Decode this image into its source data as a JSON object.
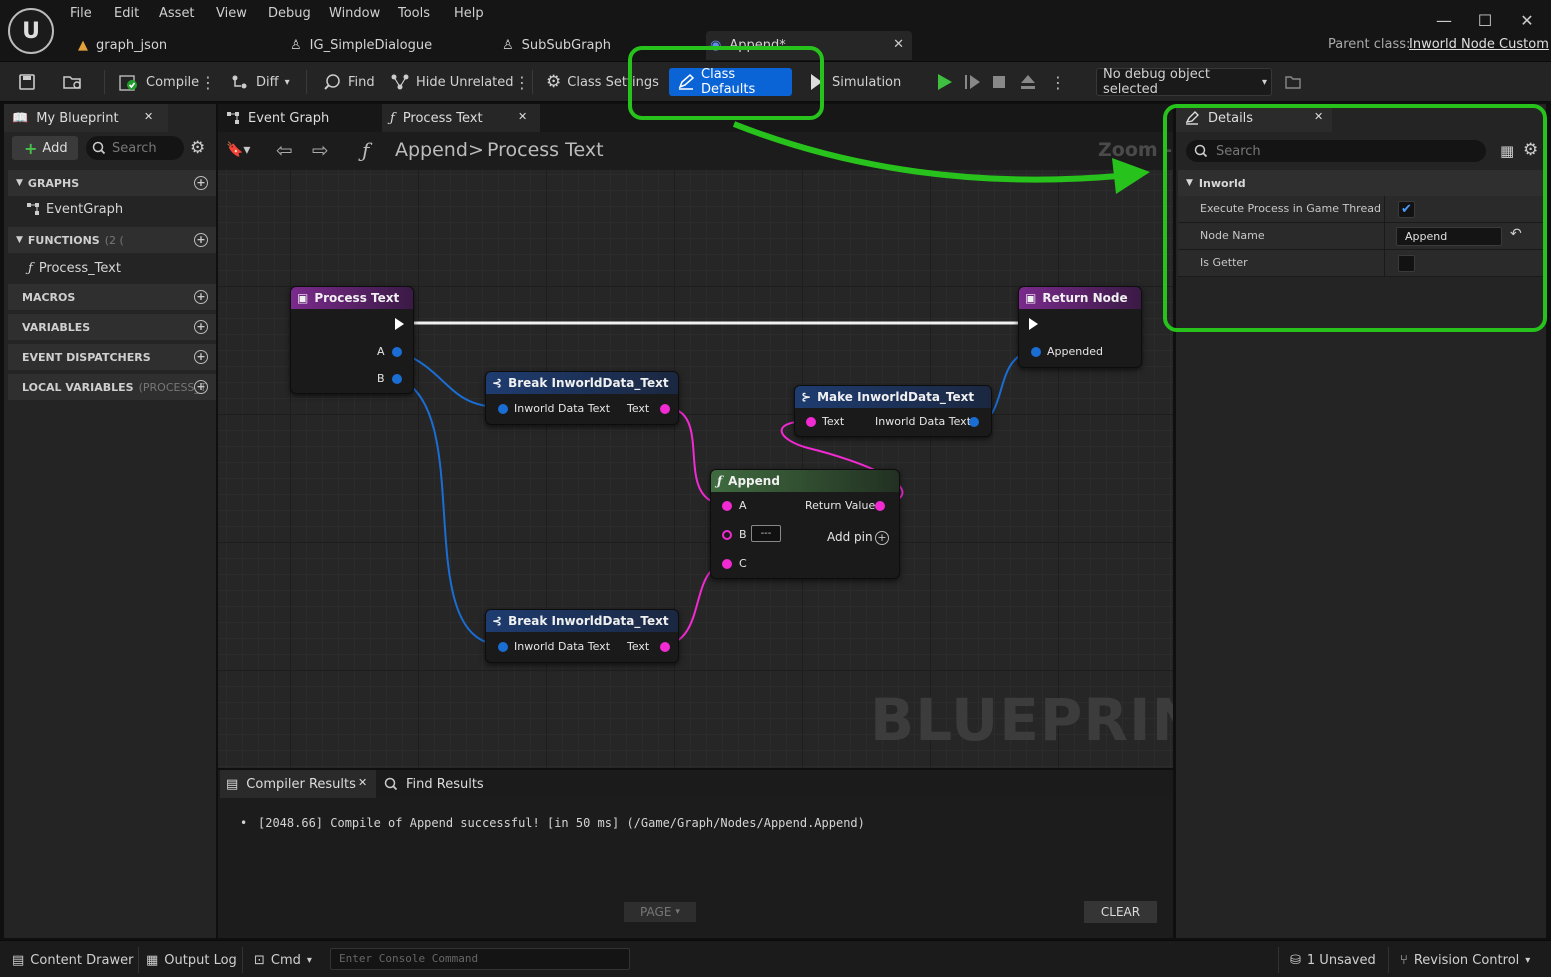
{
  "menu": [
    "File",
    "Edit",
    "Asset",
    "View",
    "Debug",
    "Window",
    "Tools",
    "Help"
  ],
  "doc_tabs": [
    {
      "label": "graph_json"
    },
    {
      "label": "IG_SimpleDialogue"
    },
    {
      "label": "SubSubGraph"
    },
    {
      "label": "Append*"
    }
  ],
  "parent_class": {
    "label": "Parent class:",
    "value": "Inworld Node Custom"
  },
  "toolbar": {
    "compile": "Compile",
    "diff": "Diff",
    "find": "Find",
    "hide_unrelated": "Hide Unrelated",
    "class_settings": "Class Settings",
    "class_defaults": "Class Defaults",
    "simulation": "Simulation",
    "debug_object": "No debug object selected"
  },
  "my_blueprint": {
    "tab": "My Blueprint",
    "add": "Add",
    "search_placeholder": "Search",
    "sections": {
      "graphs": "GRAPHS",
      "graphs_items": [
        "EventGraph"
      ],
      "functions": "FUNCTIONS",
      "functions_count": "(2 (",
      "functions_items": [
        "Process_Text"
      ],
      "macros": "MACROS",
      "variables": "VARIABLES",
      "event_dispatchers": "EVENT DISPATCHERS",
      "local_variables": "LOCAL VARIABLES",
      "local_variables_scope": "(PROCESS_T"
    }
  },
  "graph_tabs": [
    "Event Graph",
    "Process Text"
  ],
  "breadcrumb": {
    "root": "Append",
    "sep": ">",
    "current": "Process Text",
    "zoom": "Zoom -"
  },
  "nodes": {
    "process_text": {
      "title": "Process Text",
      "pins": [
        "A",
        "B"
      ]
    },
    "return_node": {
      "title": "Return Node",
      "pin": "Appended"
    },
    "break1": {
      "title": "Break InworldData_Text",
      "in": "Inworld Data Text",
      "out": "Text"
    },
    "break2": {
      "title": "Break InworldData_Text",
      "in": "Inworld Data Text",
      "out": "Text"
    },
    "make": {
      "title": "Make InworldData_Text",
      "in": "Text",
      "out": "Inworld Data Text"
    },
    "append": {
      "title": "Append",
      "a": "A",
      "b": "B",
      "b_value": "---",
      "c": "C",
      "ret": "Return Value",
      "add_pin": "Add pin"
    }
  },
  "watermark": "BLUEPRINT",
  "results": {
    "tabs": [
      "Compiler Results",
      "Find Results"
    ],
    "log": "[2048.66] Compile of Append successful! [in 50 ms] (/Game/Graph/Nodes/Append.Append)",
    "page": "PAGE",
    "clear": "CLEAR"
  },
  "details": {
    "tab": "Details",
    "search_placeholder": "Search",
    "category": "Inworld",
    "rows": [
      {
        "label": "Execute Process in Game Thread",
        "checked": true
      },
      {
        "label": "Node Name",
        "value": "Append"
      },
      {
        "label": "Is Getter",
        "checked": false
      }
    ]
  },
  "statusbar": {
    "content_drawer": "Content Drawer",
    "output_log": "Output Log",
    "cmd": "Cmd",
    "console_placeholder": "Enter Console Command",
    "unsaved": "1 Unsaved",
    "revision_control": "Revision Control"
  },
  "colors": {
    "highlight_green": "#27c21b",
    "class_defaults_blue": "#0a64d6",
    "pin_blue": "#1a6dd3",
    "pin_pink": "#f12ad2"
  }
}
